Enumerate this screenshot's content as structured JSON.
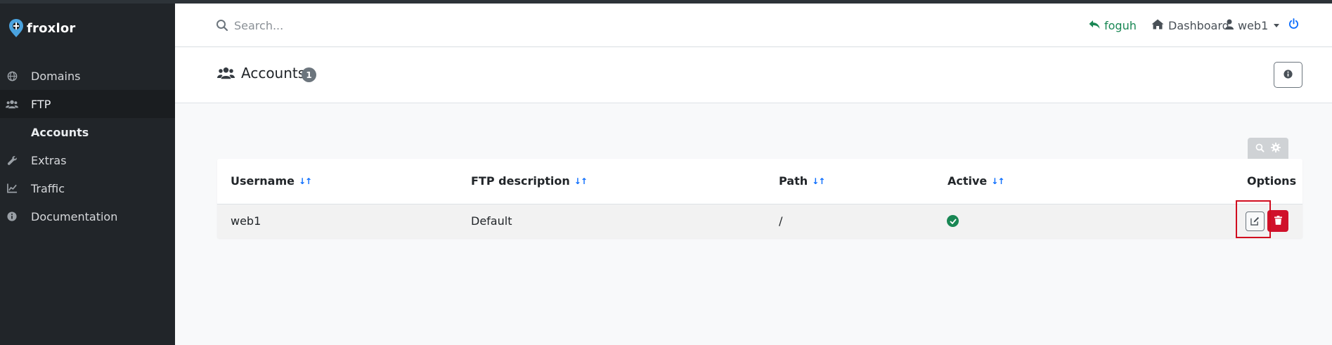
{
  "brand": {
    "name": "froxlor"
  },
  "sidebar": {
    "items": [
      {
        "label": "Domains",
        "icon": "globe-icon"
      },
      {
        "label": "FTP",
        "icon": "users-icon"
      },
      {
        "label": "Accounts"
      },
      {
        "label": "Extras",
        "icon": "wrench-icon"
      },
      {
        "label": "Traffic",
        "icon": "chart-icon"
      },
      {
        "label": "Documentation",
        "icon": "info-circle-icon"
      }
    ]
  },
  "topbar": {
    "search_placeholder": "Search...",
    "switch_user": "foguh",
    "dashboard": "Dashboard",
    "user": "web1"
  },
  "page": {
    "title": "Accounts",
    "count": "1"
  },
  "table": {
    "headers": [
      "Username",
      "FTP description",
      "Path",
      "Active",
      "Options"
    ],
    "sort_glyph": "↓↑",
    "rows": [
      {
        "username": "web1",
        "description": "Default",
        "path": "/",
        "active": true
      }
    ]
  },
  "colors": {
    "sidebar": "#212529",
    "accent_green": "#198754",
    "danger": "#d0112b",
    "link_blue": "#0d6efd"
  }
}
